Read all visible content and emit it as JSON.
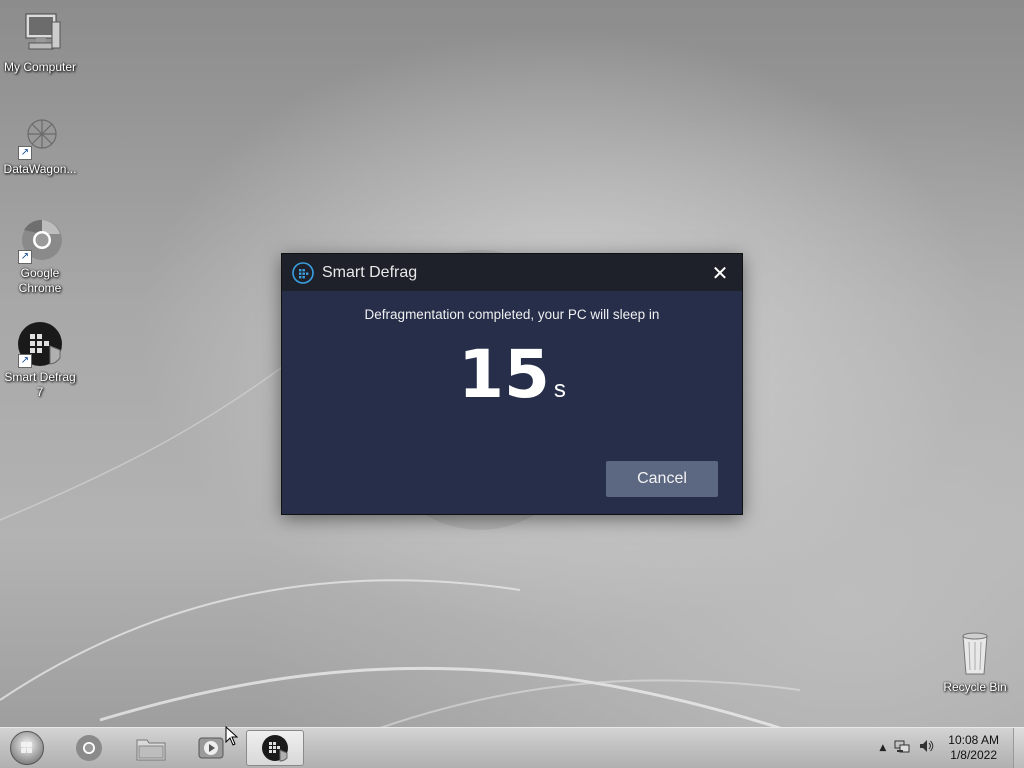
{
  "desktop": {
    "icons": [
      {
        "label": "My Computer",
        "icon": "computer-icon"
      },
      {
        "label": "DataWagon...",
        "icon": "datawagon-icon"
      },
      {
        "label": "Google Chrome",
        "icon": "chrome-icon"
      },
      {
        "label": "Smart Defrag 7",
        "icon": "smart-defrag-icon"
      },
      {
        "label": "Recycle Bin",
        "icon": "recycle-bin-icon"
      }
    ]
  },
  "dialog": {
    "title": "Smart Defrag",
    "message": "Defragmentation completed, your PC will sleep in",
    "countdown_value": "15",
    "countdown_unit": "s",
    "cancel_label": "Cancel",
    "close_glyph": "✕"
  },
  "taskbar": {
    "items": [
      {
        "icon": "start-orb-icon"
      },
      {
        "icon": "chrome-icon"
      },
      {
        "icon": "file-explorer-icon"
      },
      {
        "icon": "media-player-icon"
      },
      {
        "icon": "smart-defrag-icon",
        "active": true
      }
    ],
    "tray": {
      "show_hidden": "▲",
      "network_icon": "network-icon",
      "volume_icon": "volume-icon"
    },
    "clock": {
      "time": "10:08 AM",
      "date": "1/8/2022"
    }
  },
  "colors": {
    "dialog_bg": "#262e4a",
    "dialog_titlebar": "#1e2129",
    "cancel_button": "#5c6782"
  }
}
